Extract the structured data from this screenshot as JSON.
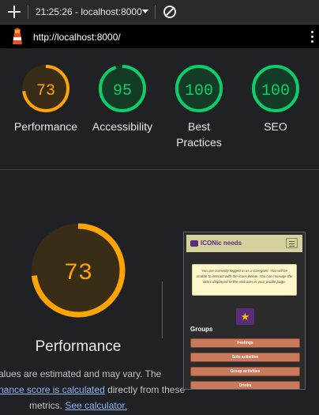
{
  "toolbar": {
    "time_host": "21:25:26 - localhost:8000"
  },
  "urlbar": {
    "url": "http://localhost:8000/"
  },
  "scores": [
    {
      "label": "Performance",
      "value": "73",
      "fraction": 0.73,
      "status": "average",
      "color": "#ffa400",
      "text_color": "#ffa400",
      "fill": "#3a2d17"
    },
    {
      "label": "Accessibility",
      "value": "95",
      "fraction": 0.95,
      "status": "pass",
      "color": "#0cce6b",
      "text_color": "#0cce6b",
      "fill": "#133b26"
    },
    {
      "label": "Best Practices",
      "value": "100",
      "fraction": 1.0,
      "status": "pass",
      "color": "#0cce6b",
      "text_color": "#0cce6b",
      "fill": "#133b26"
    },
    {
      "label": "SEO",
      "value": "100",
      "fraction": 1.0,
      "status": "pass",
      "color": "#0cce6b",
      "text_color": "#0cce6b",
      "fill": "#133b26"
    }
  ],
  "performance": {
    "value": "73",
    "fraction": 0.73,
    "title": "Performance",
    "note_line1": "alues are estimated and may vary. The",
    "note_link1": "nance score is calculated",
    "note_line2_rest": " directly from these",
    "note_line3_pre": "metrics. ",
    "note_link2": "See calculator."
  },
  "thumbnail": {
    "logo_text": "ICONic needs",
    "notice": "You are currently logged in as a caregiver. You will be unable to interact with the icons below. You can manage the icons displayed to the end user in your profile page.",
    "star": "★",
    "groups_heading": "Groups",
    "buttons": [
      "Feelings",
      "Solo activities",
      "Group activities",
      "Drinks"
    ]
  },
  "colors": {
    "average": "#ffa400",
    "pass": "#0cce6b",
    "link": "#8ab4f8",
    "background": "#202124"
  }
}
